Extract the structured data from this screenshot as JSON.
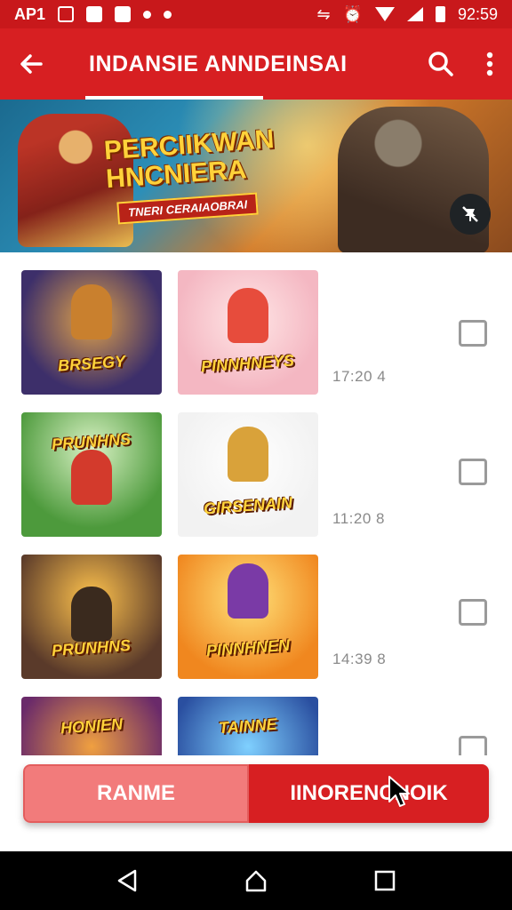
{
  "status_bar": {
    "left_text": "AP1",
    "time": "92:59"
  },
  "app_bar": {
    "title": "INDANSIE ANNDEINSAI",
    "back_icon": "arrow-left-icon",
    "search_icon": "search-icon",
    "more_icon": "more-vert-icon"
  },
  "banner": {
    "headline_line1": "PERCIIKWAN",
    "headline_line2": "HNCNIERA",
    "tagline": "TNERI CERAIAOBRAI",
    "pin_icon": "pin-off-icon"
  },
  "list": {
    "rows": [
      {
        "thumb_a": "BRSEGY",
        "thumb_b": "PINNHNEYS",
        "time": "17:20 4"
      },
      {
        "thumb_a": "PRUNHNS",
        "thumb_b": "GIRSENAIN",
        "time": "11:20 8"
      },
      {
        "thumb_a": "PRUNHNS",
        "thumb_b": "PINNHNEN",
        "time": "14:39 8"
      },
      {
        "thumb_a": "HONIEN",
        "thumb_b": "TAINNE",
        "time": ""
      }
    ]
  },
  "actions": {
    "left_label": "RANME",
    "right_label": "IINORENCNOIK"
  },
  "nav_bar": {
    "back_icon": "nav-back-icon",
    "home_icon": "nav-home-icon",
    "recents_icon": "nav-recents-icon"
  },
  "colors": {
    "primary": "#d71f22",
    "status": "#c8181b",
    "secondary_button": "#f27b7b"
  }
}
